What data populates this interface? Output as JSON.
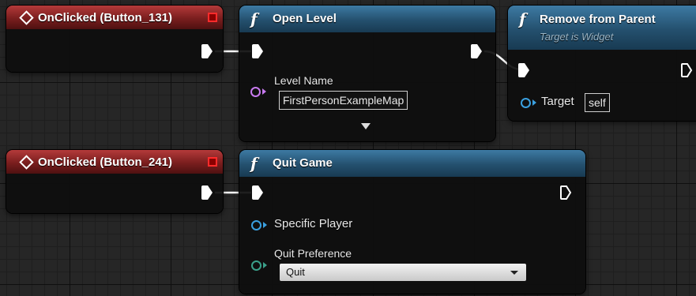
{
  "nodes": {
    "event1": {
      "title": "OnClicked (Button_131)"
    },
    "event2": {
      "title": "OnClicked (Button_241)"
    },
    "open_level": {
      "title": "Open Level",
      "pin_level_name_label": "Level Name",
      "pin_level_name_value": "FirstPersonExampleMap"
    },
    "remove_from_parent": {
      "title": "Remove from Parent",
      "subtitle": "Target is Widget",
      "pin_target_label": "Target",
      "pin_target_value": "self"
    },
    "quit_game": {
      "title": "Quit Game",
      "pin_specific_player_label": "Specific Player",
      "pin_quit_preference_label": "Quit Preference",
      "pin_quit_preference_value": "Quit"
    }
  },
  "icons": {
    "function": "f",
    "event": "diamond-icon",
    "delegate": "red-square-icon",
    "exec_pin": "exec-arrow-icon"
  },
  "colors": {
    "event_header": "#8a2222",
    "function_header": "#2a5a7a",
    "string_pin": "#c87af0",
    "object_pin": "#3aa0e0",
    "byte_pin": "#3aa08a",
    "wire": "#ffffff"
  }
}
